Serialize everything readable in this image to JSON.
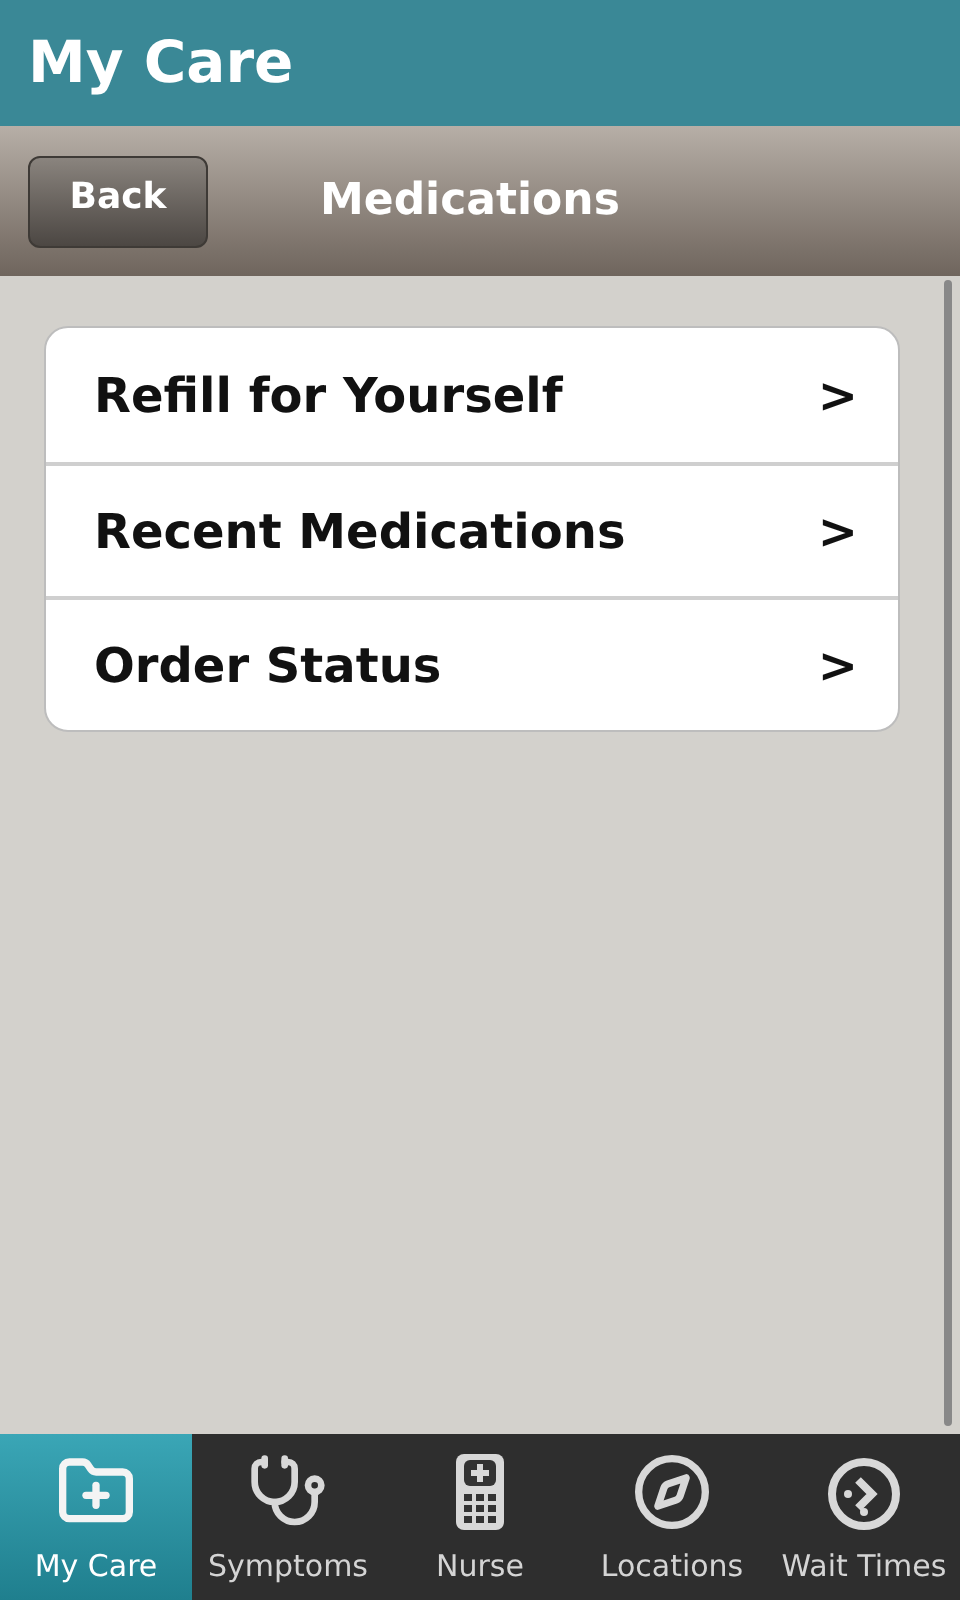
{
  "app_bar": {
    "title": "My Care"
  },
  "nav_bar": {
    "back_button": "Back",
    "title": "Medications"
  },
  "menu_items": [
    {
      "label": "Refill for Yourself",
      "chevron": ">"
    },
    {
      "label": "Recent Medications",
      "chevron": ">"
    },
    {
      "label": "Order Status",
      "chevron": ">"
    }
  ],
  "tabs": [
    {
      "label": "My Care",
      "kind": "folder",
      "selected": true
    },
    {
      "label": "Symptoms",
      "kind": "stethoscope",
      "selected": false
    },
    {
      "label": "Nurse",
      "kind": "phone",
      "selected": false
    },
    {
      "label": "Locations",
      "kind": "compass",
      "selected": false
    },
    {
      "label": "Wait Times",
      "kind": "clock",
      "selected": false
    }
  ]
}
